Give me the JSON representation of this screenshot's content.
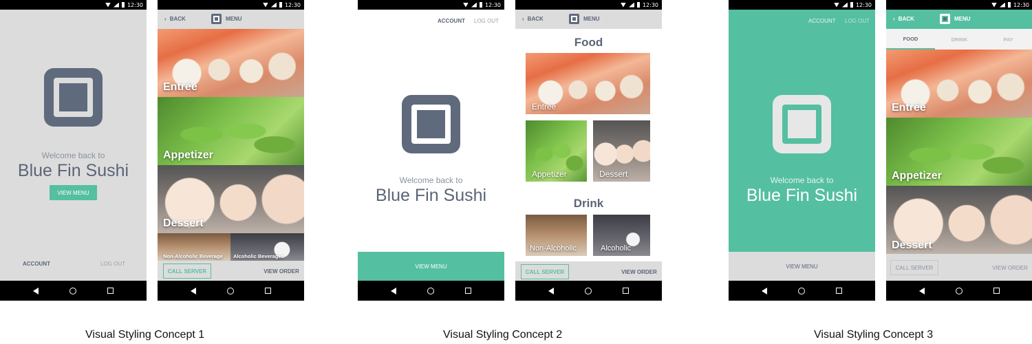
{
  "status": {
    "time": "12:30"
  },
  "common": {
    "welcome": "Welcome back to",
    "restaurant": "Blue Fin Sushi",
    "back": "BACK",
    "menu": "MENU",
    "account": "ACCOUNT",
    "logout": "LOG OUT",
    "view_menu": "VIEW MENU",
    "call_server": "CALL SERVER",
    "view_order": "VIEW ORDER"
  },
  "categories": {
    "entree": "Entrée",
    "appetizer": "Appetizer",
    "dessert": "Dessert",
    "non_alcoholic_beverage": "Non-Alcoholic Beverage",
    "alcoholic_beverages": "Alcoholic Beverages",
    "non_alcoholic": "Non-Alcoholic",
    "alcoholic": "Alcoholic"
  },
  "concept2": {
    "food_heading": "Food",
    "drink_heading": "Drink"
  },
  "concept3": {
    "tabs": [
      "FOOD",
      "DRINK",
      "PAY"
    ]
  },
  "captions": [
    "Visual Styling Concept 1",
    "Visual Styling Concept 2",
    "Visual Styling Concept 3"
  ],
  "colors": {
    "slate": "#5f6a7d",
    "teal": "#55bfa1",
    "light_gray": "#dcdcdc"
  },
  "icons": [
    "back-arrow-icon",
    "home-circle-icon",
    "recent-apps-icon",
    "wifi-icon",
    "signal-icon",
    "battery-icon",
    "square-logo-icon",
    "chevron-left-icon"
  ]
}
